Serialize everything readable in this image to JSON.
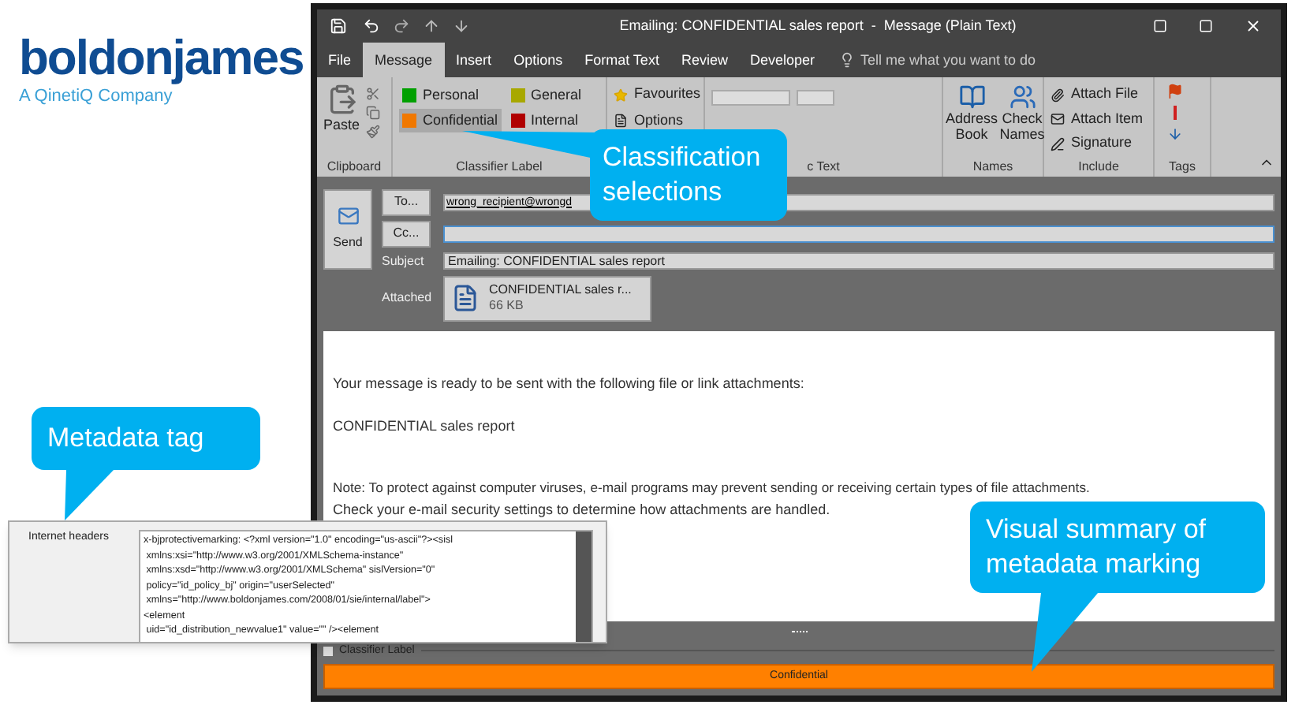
{
  "logo": {
    "name": "boldonjames",
    "tagline": "A QinetiQ Company"
  },
  "window": {
    "title": "Emailing: CONFIDENTIAL sales report  -  Message (Plain Text)"
  },
  "tabs": [
    {
      "label": "File",
      "selected": false
    },
    {
      "label": "Message",
      "selected": true
    },
    {
      "label": "Insert",
      "selected": false
    },
    {
      "label": "Options",
      "selected": false
    },
    {
      "label": "Format Text",
      "selected": false
    },
    {
      "label": "Review",
      "selected": false
    },
    {
      "label": "Developer",
      "selected": false
    }
  ],
  "tell_me": "Tell me what you want to do",
  "ribbon": {
    "clipboard": {
      "paste": "Paste",
      "group_label": "Clipboard"
    },
    "classifier": {
      "group_label": "Classifier Label",
      "labels": [
        {
          "label": "Personal",
          "color": "#00a000",
          "selected": false
        },
        {
          "label": "General",
          "color": "#a8a800",
          "selected": false
        },
        {
          "label": "Confidential",
          "color": "#f07800",
          "selected": true
        },
        {
          "label": "Internal",
          "color": "#b00000",
          "selected": false
        }
      ]
    },
    "favourites": [
      "Favourites",
      "Options"
    ],
    "basic_text": {
      "group_label": "c Text"
    },
    "names": {
      "group_label": "Names",
      "items": [
        "Address Book",
        "Check Names"
      ]
    },
    "include": {
      "group_label": "Include",
      "items": [
        "Attach File",
        "Attach Item",
        "Signature"
      ]
    },
    "tags": {
      "group_label": "Tags"
    }
  },
  "compose": {
    "send": "Send",
    "to_button": "To...",
    "to_value": "wrong_recipient@wrongd",
    "cc_button": "Cc...",
    "subject_label": "Subject",
    "subject": "Emailing: CONFIDENTIAL sales report",
    "attached_label": "Attached",
    "attachment": {
      "name": "CONFIDENTIAL sales r...",
      "size": "66 KB"
    }
  },
  "body": [
    "Your message is ready to be sent with the following file or link attachments:",
    "CONFIDENTIAL sales report",
    "Note: To protect against computer viruses, e-mail programs may prevent sending or receiving certain types of file attachments.",
    "Check your e-mail security settings to determine how attachments are handled."
  ],
  "classifier_bar": {
    "heading": "Classifier Label",
    "value": "Confidential"
  },
  "headers_panel": {
    "label": "Internet headers",
    "lines": [
      "x-bjprotectivemarking: <?xml version=\"1.0\" encoding=\"us-ascii\"?><sisl",
      " xmlns:xsi=\"http://www.w3.org/2001/XMLSchema-instance\"",
      " xmlns:xsd=\"http://www.w3.org/2001/XMLSchema\" sislVersion=\"0\"",
      " policy=\"id_policy_bj\" origin=\"userSelected\"",
      " xmlns=\"http://www.boldonjames.com/2008/01/sie/internal/label\">",
      "<element",
      " uid=\"id_distribution_newvalue1\" value=\"\" /><element"
    ]
  },
  "callouts": [
    {
      "text": "Classification selections"
    },
    {
      "text": "Metadata tag"
    },
    {
      "text": "Visual summary of metadata marking"
    }
  ]
}
